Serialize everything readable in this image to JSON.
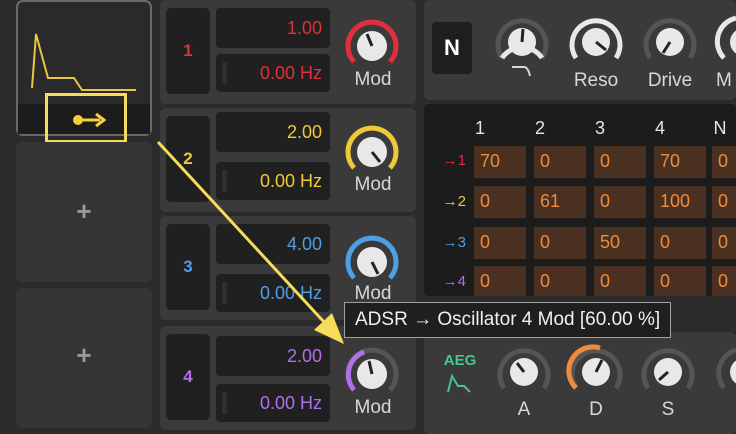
{
  "modulator_slots": {
    "add_label": "+"
  },
  "voices": [
    {
      "index": "1",
      "color": "#e0303e",
      "amount": "1.00",
      "rate": "0.00 Hz",
      "knob_label": "Mod"
    },
    {
      "index": "2",
      "color": "#f0c93a",
      "amount": "2.00",
      "rate": "0.00 Hz",
      "knob_label": "Mod"
    },
    {
      "index": "3",
      "color": "#4f9fe6",
      "amount": "4.00",
      "rate": "0.00 Hz",
      "knob_label": "Mod"
    },
    {
      "index": "4",
      "color": "#b070ec",
      "amount": "2.00",
      "rate": "0.00 Hz",
      "knob_label": "Mod"
    }
  ],
  "filter": {
    "mode_label": "N",
    "knobs": [
      "",
      "Reso",
      "Drive",
      "M"
    ]
  },
  "matrix": {
    "col_headers": [
      "1",
      "2",
      "3",
      "4",
      "N"
    ],
    "rows": [
      {
        "label": "→1",
        "color": "#e0303e",
        "values": [
          "70",
          "0",
          "0",
          "70",
          "0"
        ]
      },
      {
        "label": "→2",
        "color": "#f0c93a",
        "values": [
          "0",
          "61",
          "0",
          "100",
          "0"
        ]
      },
      {
        "label": "→3",
        "color": "#4f9fe6",
        "values": [
          "0",
          "0",
          "50",
          "0",
          "0"
        ]
      },
      {
        "label": "→4",
        "color": "#b070ec",
        "values": [
          "0",
          "0",
          "0",
          "0",
          "0"
        ]
      }
    ]
  },
  "aeg": {
    "title": "AEG",
    "knobs": [
      "A",
      "D",
      "S",
      ""
    ]
  },
  "tooltip": {
    "text": "ADSR → Oscillator 4 Mod [60.00 %]"
  },
  "colors": {
    "highlight": "#f5dc5a",
    "accent_orange": "#f08a3c",
    "aeg_green": "#3ec98a"
  }
}
